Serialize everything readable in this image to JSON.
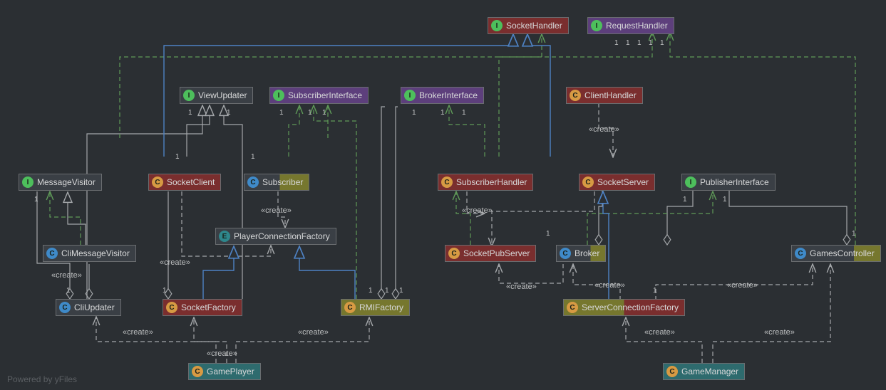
{
  "diagram": {
    "footer": "Powered by yFiles",
    "stereotype_create": "«create»",
    "mult_one": "1",
    "nodes": {
      "SocketHandler": {
        "label": "SocketHandler",
        "icon": "I"
      },
      "RequestHandler": {
        "label": "RequestHandler",
        "icon": "I"
      },
      "ViewUpdater": {
        "label": "ViewUpdater",
        "icon": "I"
      },
      "SubscriberInterface": {
        "label": "SubscriberInterface",
        "icon": "I"
      },
      "BrokerInterface": {
        "label": "BrokerInterface",
        "icon": "I"
      },
      "ClientHandler": {
        "label": "ClientHandler",
        "icon": "C"
      },
      "MessageVisitor": {
        "label": "MessageVisitor",
        "icon": "I"
      },
      "SocketClient": {
        "label": "SocketClient",
        "icon": "C"
      },
      "Subscriber": {
        "label": "Subscriber",
        "icon": "C"
      },
      "SubscriberHandler": {
        "label": "SubscriberHandler",
        "icon": "C"
      },
      "SocketServer": {
        "label": "SocketServer",
        "icon": "C"
      },
      "PublisherInterface": {
        "label": "PublisherInterface",
        "icon": "I"
      },
      "CliMessageVisitor": {
        "label": "CliMessageVisitor",
        "icon": "C"
      },
      "PlayerConnectionFactory": {
        "label": "PlayerConnectionFactory",
        "icon": "E"
      },
      "SocketPubServer": {
        "label": "SocketPubServer",
        "icon": "C"
      },
      "Broker": {
        "label": "Broker",
        "icon": "C"
      },
      "GamesController": {
        "label": "GamesController",
        "icon": "C"
      },
      "CliUpdater": {
        "label": "CliUpdater",
        "icon": "C"
      },
      "SocketFactory": {
        "label": "SocketFactory",
        "icon": "C"
      },
      "RMIFactory": {
        "label": "RMIFactory",
        "icon": "C"
      },
      "ServerConnectionFactory": {
        "label": "ServerConnectionFactory",
        "icon": "C"
      },
      "GamePlayer": {
        "label": "GamePlayer",
        "icon": "C"
      },
      "GameManager": {
        "label": "GameManager",
        "icon": "C"
      }
    }
  }
}
